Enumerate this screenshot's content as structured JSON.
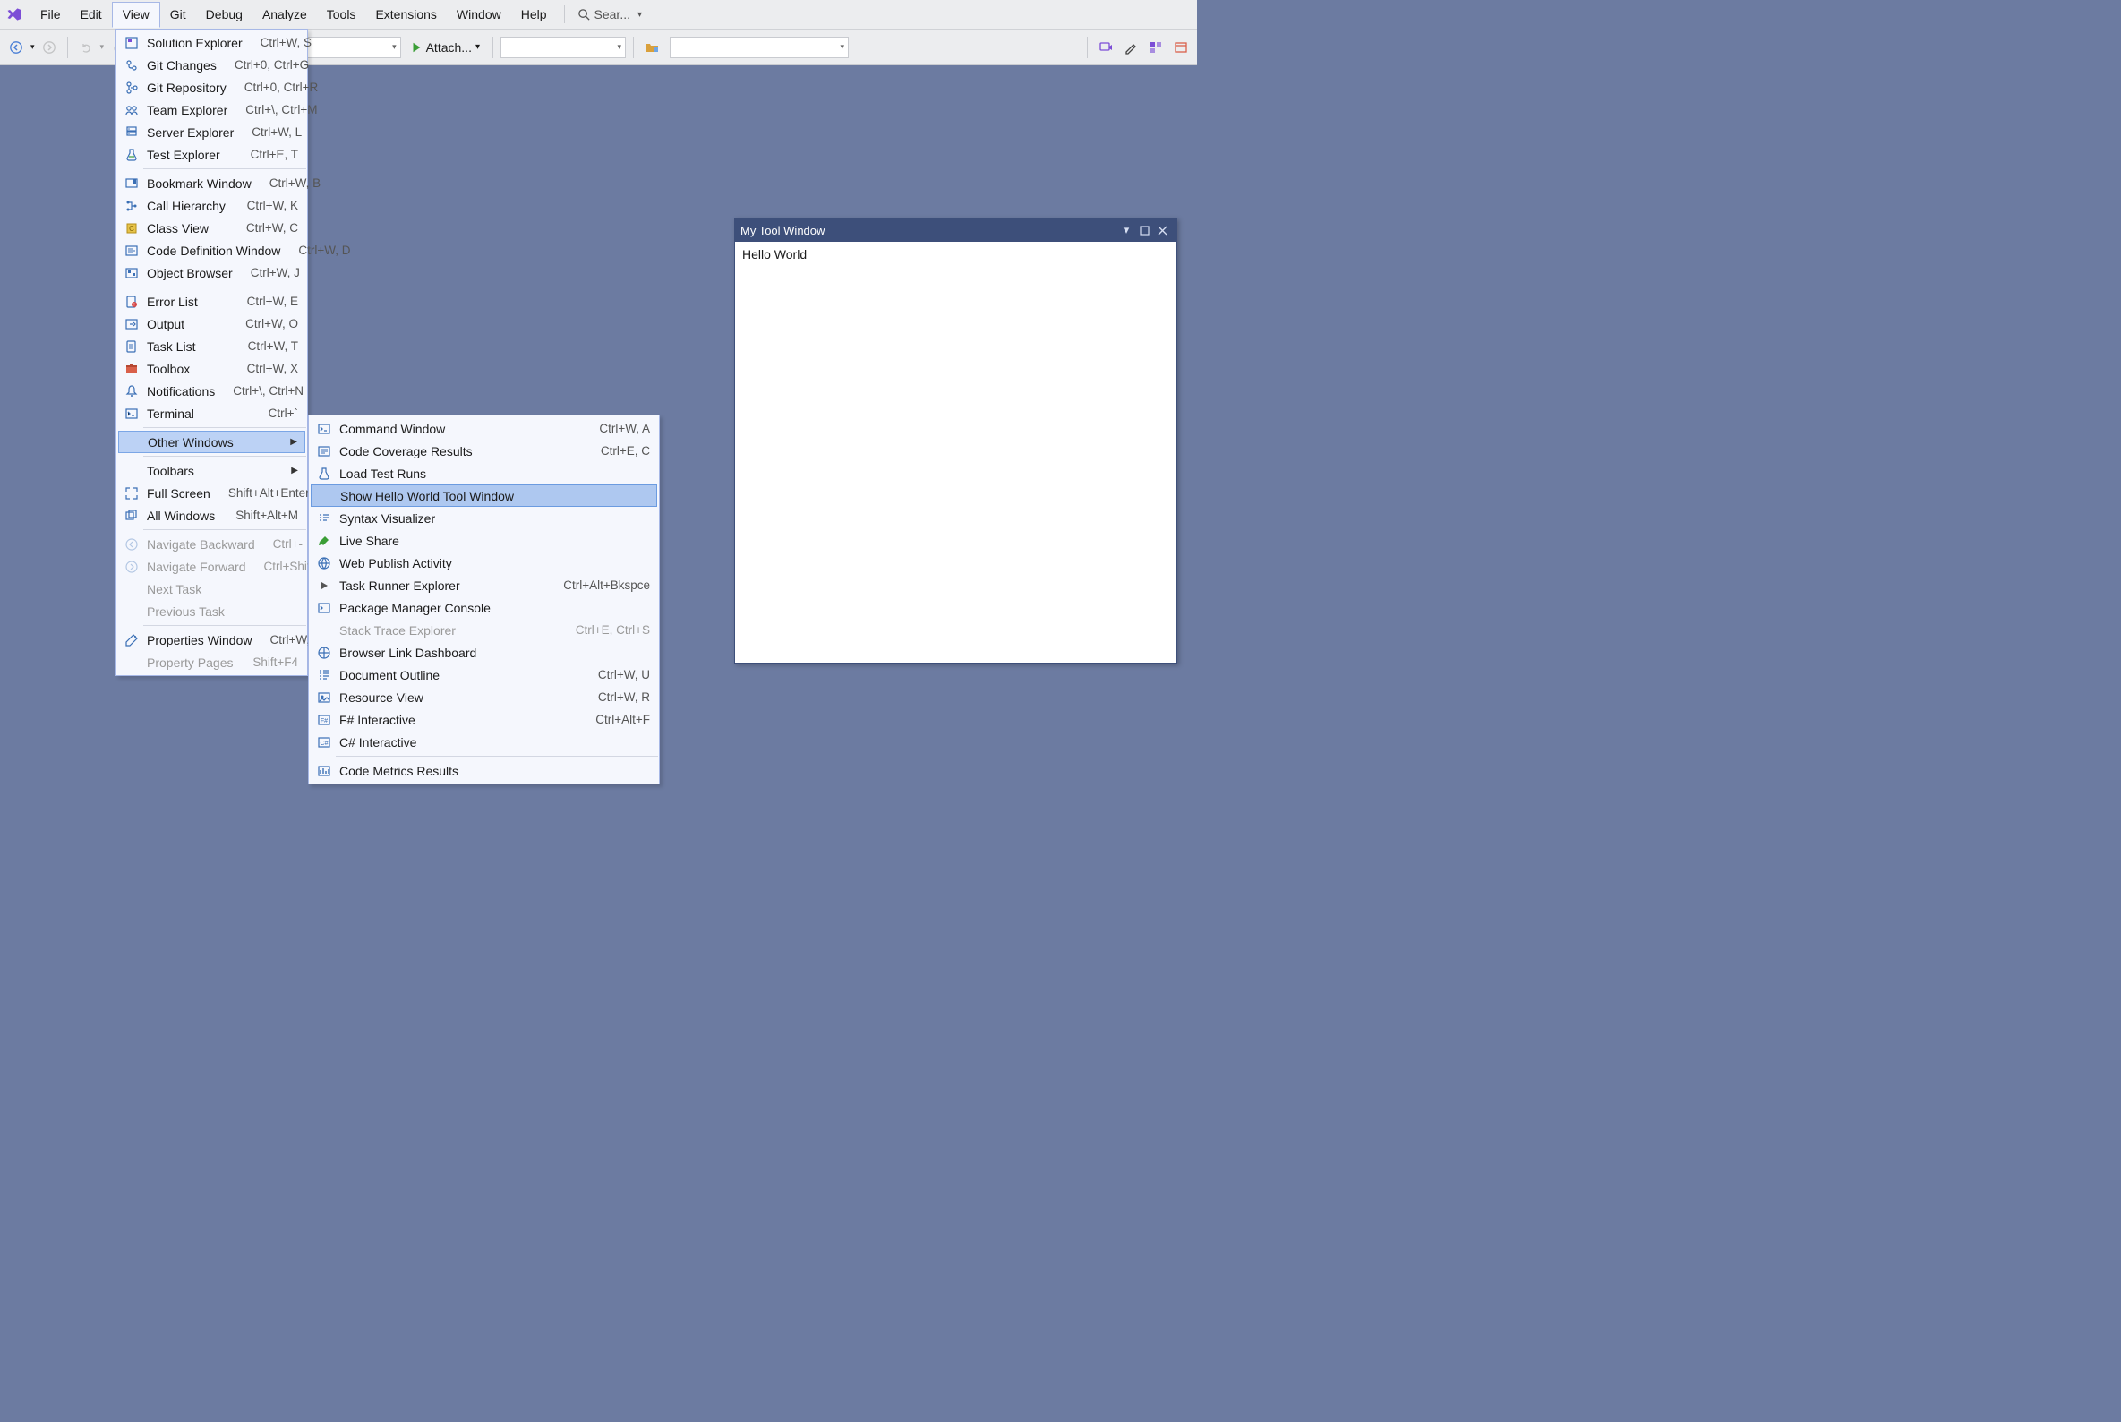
{
  "menubar": {
    "items": [
      "File",
      "Edit",
      "View",
      "Git",
      "Debug",
      "Analyze",
      "Tools",
      "Extensions",
      "Window",
      "Help"
    ],
    "open_index": 2,
    "search_placeholder": "Sear..."
  },
  "toolbar": {
    "attach_label": "Attach..."
  },
  "view_menu": [
    {
      "icon": "solution-explorer-icon",
      "label": "Solution Explorer",
      "shortcut": "Ctrl+W, S"
    },
    {
      "icon": "git-changes-icon",
      "label": "Git Changes",
      "shortcut": "Ctrl+0, Ctrl+G"
    },
    {
      "icon": "git-repository-icon",
      "label": "Git Repository",
      "shortcut": "Ctrl+0, Ctrl+R"
    },
    {
      "icon": "team-explorer-icon",
      "label": "Team Explorer",
      "shortcut": "Ctrl+\\, Ctrl+M"
    },
    {
      "icon": "server-explorer-icon",
      "label": "Server Explorer",
      "shortcut": "Ctrl+W, L"
    },
    {
      "icon": "test-explorer-icon",
      "label": "Test Explorer",
      "shortcut": "Ctrl+E, T"
    },
    {
      "sep": true
    },
    {
      "icon": "bookmark-window-icon",
      "label": "Bookmark Window",
      "shortcut": "Ctrl+W, B"
    },
    {
      "icon": "call-hierarchy-icon",
      "label": "Call Hierarchy",
      "shortcut": "Ctrl+W, K"
    },
    {
      "icon": "class-view-icon",
      "label": "Class View",
      "shortcut": "Ctrl+W, C"
    },
    {
      "icon": "code-definition-icon",
      "label": "Code Definition Window",
      "shortcut": "Ctrl+W, D"
    },
    {
      "icon": "object-browser-icon",
      "label": "Object Browser",
      "shortcut": "Ctrl+W, J"
    },
    {
      "sep": true
    },
    {
      "icon": "error-list-icon",
      "label": "Error List",
      "shortcut": "Ctrl+W, E"
    },
    {
      "icon": "output-icon",
      "label": "Output",
      "shortcut": "Ctrl+W, O"
    },
    {
      "icon": "task-list-icon",
      "label": "Task List",
      "shortcut": "Ctrl+W, T"
    },
    {
      "icon": "toolbox-icon",
      "label": "Toolbox",
      "shortcut": "Ctrl+W, X"
    },
    {
      "icon": "notifications-icon",
      "label": "Notifications",
      "shortcut": "Ctrl+\\, Ctrl+N"
    },
    {
      "icon": "terminal-icon",
      "label": "Terminal",
      "shortcut": "Ctrl+`"
    },
    {
      "sep": true
    },
    {
      "icon": "",
      "label": "Other Windows",
      "shortcut": "",
      "submenu": true,
      "highlight": true
    },
    {
      "sep": true
    },
    {
      "icon": "",
      "label": "Toolbars",
      "shortcut": "",
      "submenu": true
    },
    {
      "icon": "fullscreen-icon",
      "label": "Full Screen",
      "shortcut": "Shift+Alt+Enter"
    },
    {
      "icon": "all-windows-icon",
      "label": "All Windows",
      "shortcut": "Shift+Alt+M"
    },
    {
      "sep": true
    },
    {
      "icon": "navigate-backward-icon",
      "label": "Navigate Backward",
      "shortcut": "Ctrl+-",
      "disabled": true
    },
    {
      "icon": "navigate-forward-icon",
      "label": "Navigate Forward",
      "shortcut": "Ctrl+Shift+-",
      "disabled": true
    },
    {
      "icon": "",
      "label": "Next Task",
      "shortcut": "",
      "disabled": true
    },
    {
      "icon": "",
      "label": "Previous Task",
      "shortcut": "",
      "disabled": true
    },
    {
      "sep": true
    },
    {
      "icon": "properties-icon",
      "label": "Properties Window",
      "shortcut": "Ctrl+W, P"
    },
    {
      "icon": "",
      "label": "Property Pages",
      "shortcut": "Shift+F4",
      "disabled": true
    }
  ],
  "other_windows_menu": [
    {
      "icon": "command-window-icon",
      "label": "Command Window",
      "shortcut": "Ctrl+W, A"
    },
    {
      "icon": "code-coverage-icon",
      "label": "Code Coverage Results",
      "shortcut": "Ctrl+E, C"
    },
    {
      "icon": "load-test-icon",
      "label": "Load Test Runs",
      "shortcut": ""
    },
    {
      "icon": "",
      "label": "Show Hello World Tool Window",
      "shortcut": "",
      "selected": true
    },
    {
      "icon": "syntax-visualizer-icon",
      "label": "Syntax Visualizer",
      "shortcut": ""
    },
    {
      "icon": "live-share-icon",
      "label": "Live Share",
      "shortcut": ""
    },
    {
      "icon": "web-publish-icon",
      "label": "Web Publish Activity",
      "shortcut": ""
    },
    {
      "icon": "task-runner-icon",
      "label": "Task Runner Explorer",
      "shortcut": "Ctrl+Alt+Bkspce"
    },
    {
      "icon": "package-manager-icon",
      "label": "Package Manager Console",
      "shortcut": ""
    },
    {
      "icon": "",
      "label": "Stack Trace Explorer",
      "shortcut": "Ctrl+E, Ctrl+S",
      "disabled": true
    },
    {
      "icon": "browser-link-icon",
      "label": "Browser Link Dashboard",
      "shortcut": ""
    },
    {
      "icon": "document-outline-icon",
      "label": "Document Outline",
      "shortcut": "Ctrl+W, U"
    },
    {
      "icon": "resource-view-icon",
      "label": "Resource View",
      "shortcut": "Ctrl+W, R"
    },
    {
      "icon": "fsharp-interactive-icon",
      "label": "F# Interactive",
      "shortcut": "Ctrl+Alt+F"
    },
    {
      "icon": "csharp-interactive-icon",
      "label": "C# Interactive",
      "shortcut": ""
    },
    {
      "sep": true
    },
    {
      "icon": "code-metrics-icon",
      "label": "Code Metrics Results",
      "shortcut": ""
    }
  ],
  "tool_window": {
    "title": "My Tool Window",
    "content": "Hello World"
  }
}
